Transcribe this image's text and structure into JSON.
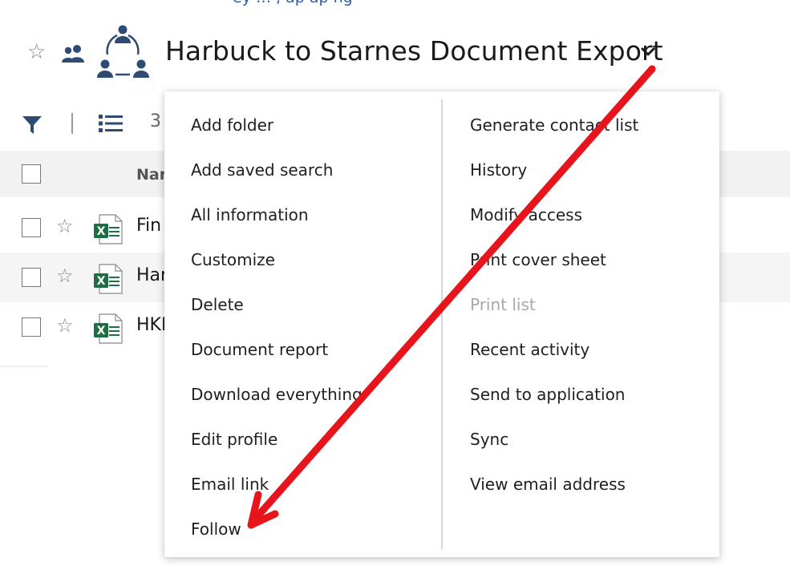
{
  "breadcrumb": {
    "fragment": "ey … , ap ap ng"
  },
  "header": {
    "title": "Harbuck to Starnes Document Export",
    "favorite_icon": "star-outline-icon",
    "members_icon": "people-icon",
    "workspace_icon": "team-cycle-icon",
    "dropdown_icon": "chevron-down-icon"
  },
  "toolbar": {
    "filter_icon": "filter-icon",
    "list_view_icon": "list-view-icon",
    "count": "3"
  },
  "table": {
    "columns": [
      "Nar"
    ],
    "rows": [
      {
        "name": "Fin",
        "type_icon": "excel-icon"
      },
      {
        "name": "Har",
        "type_icon": "excel-icon"
      },
      {
        "name": "HKI",
        "type_icon": "excel-icon"
      }
    ]
  },
  "menu": {
    "left": [
      {
        "label": "Add folder"
      },
      {
        "label": "Add saved search"
      },
      {
        "label": "All information"
      },
      {
        "label": "Customize"
      },
      {
        "label": "Delete"
      },
      {
        "label": "Document report"
      },
      {
        "label": "Download everything"
      },
      {
        "label": "Edit profile"
      },
      {
        "label": "Email link"
      },
      {
        "label": "Follow"
      }
    ],
    "right": [
      {
        "label": "Generate contact list"
      },
      {
        "label": "History"
      },
      {
        "label": "Modify access"
      },
      {
        "label": "Print cover sheet"
      },
      {
        "label": "Print list",
        "disabled": true
      },
      {
        "label": "Recent activity"
      },
      {
        "label": "Send to application"
      },
      {
        "label": "Sync"
      },
      {
        "label": "View email address"
      }
    ]
  },
  "colors": {
    "brand": "#2d4b73",
    "link": "#2f5fa8",
    "excel": "#1d6f42",
    "annotation_arrow": "#e8141b",
    "disabled_text": "#a8a8a8"
  }
}
